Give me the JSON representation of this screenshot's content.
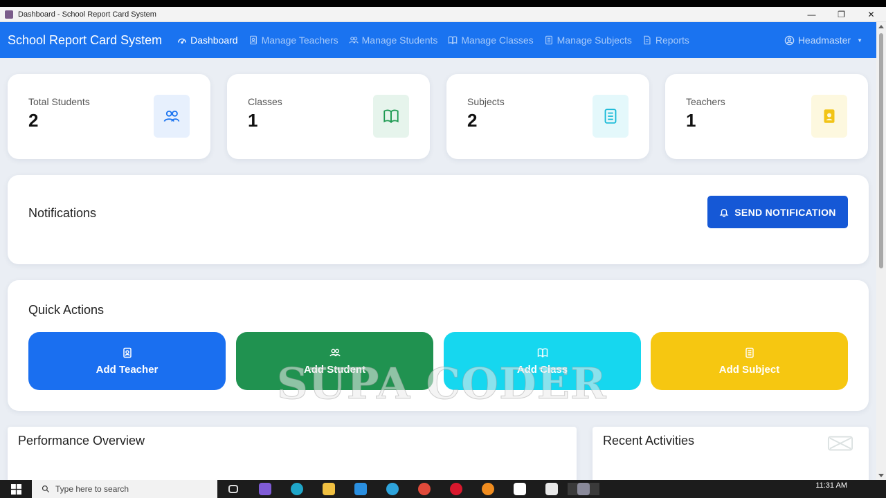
{
  "window": {
    "title": "Dashboard - School Report Card System"
  },
  "navbar": {
    "brand": "School Report Card System",
    "items": [
      {
        "label": "Dashboard",
        "icon": "speedometer-icon",
        "active": true
      },
      {
        "label": "Manage Teachers",
        "icon": "person-badge-icon",
        "active": false
      },
      {
        "label": "Manage Students",
        "icon": "people-icon",
        "active": false
      },
      {
        "label": "Manage Classes",
        "icon": "book-icon",
        "active": false
      },
      {
        "label": "Manage Subjects",
        "icon": "journal-icon",
        "active": false
      },
      {
        "label": "Reports",
        "icon": "file-text-icon",
        "active": false
      }
    ],
    "user": "Headmaster"
  },
  "stats": [
    {
      "label": "Total Students",
      "value": "2",
      "icon": "people-icon",
      "color": "#1a73f0"
    },
    {
      "label": "Classes",
      "value": "1",
      "icon": "book-icon",
      "color": "#1e9a52"
    },
    {
      "label": "Subjects",
      "value": "2",
      "icon": "journal-icon",
      "color": "#12b8d6"
    },
    {
      "label": "Teachers",
      "value": "1",
      "icon": "person-badge-icon",
      "color": "#f2c417"
    }
  ],
  "notifications": {
    "title": "Notifications",
    "button": "SEND NOTIFICATION"
  },
  "quick_actions": {
    "title": "Quick Actions",
    "buttons": [
      {
        "label": "Add Teacher",
        "icon": "person-badge-icon",
        "color": "#1a6ff0"
      },
      {
        "label": "Add Student",
        "icon": "people-icon",
        "color": "#209250"
      },
      {
        "label": "Add Class",
        "icon": "book-icon",
        "color": "#16d7ef"
      },
      {
        "label": "Add Subject",
        "icon": "journal-icon",
        "color": "#f6c711"
      }
    ]
  },
  "performance": {
    "title": "Performance Overview"
  },
  "recent": {
    "title": "Recent Activities"
  },
  "watermark": "SUPA CODER",
  "taskbar": {
    "search_placeholder": "Type here to search",
    "clock": "11:31 AM"
  }
}
